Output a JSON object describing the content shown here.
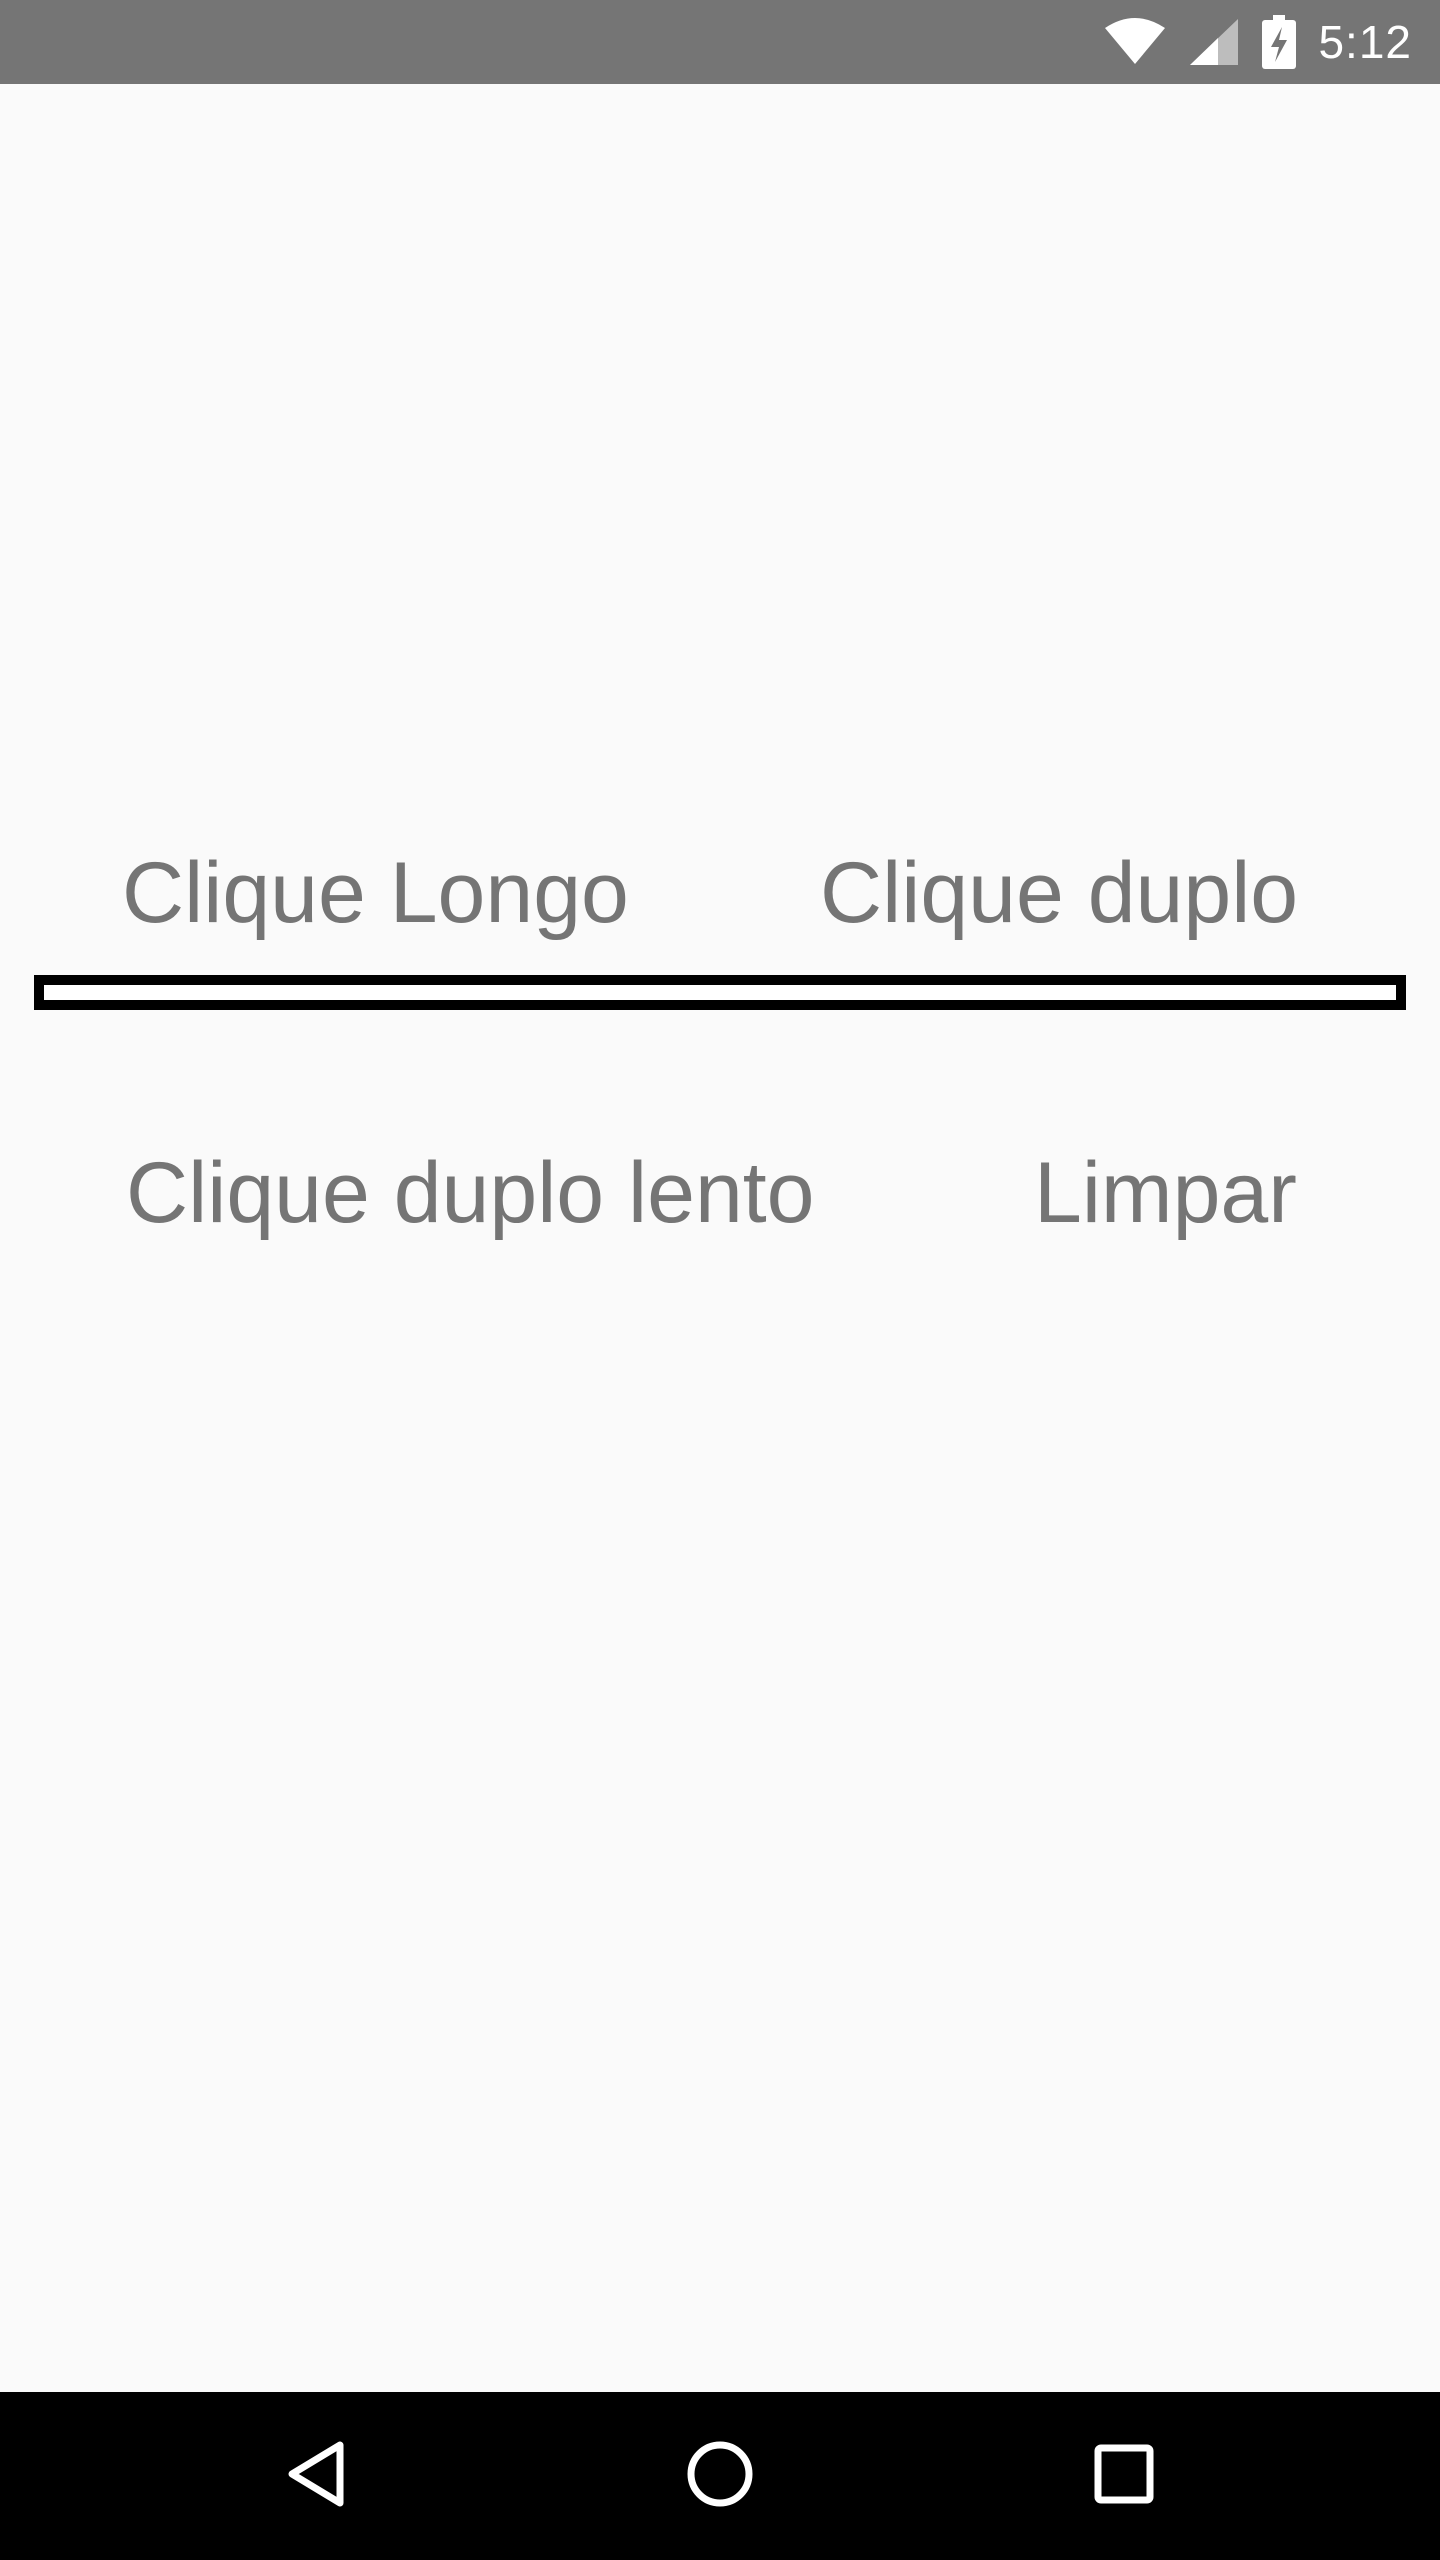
{
  "status_bar": {
    "time": "5:12",
    "icons": [
      "wifi-icon",
      "signal-icon",
      "battery-charging-icon"
    ],
    "background": "#757575"
  },
  "main": {
    "buttons": {
      "long_click": "Clique Longo",
      "double_click": "Clique duplo",
      "slow_double_click": "Clique duplo lento",
      "clear": "Limpar"
    },
    "output_text": ""
  },
  "nav_bar": {
    "icons": [
      "back-icon",
      "home-icon",
      "recents-icon"
    ]
  },
  "colors": {
    "background": "#fafafa",
    "label_text": "#757575",
    "output_border": "#000000"
  }
}
